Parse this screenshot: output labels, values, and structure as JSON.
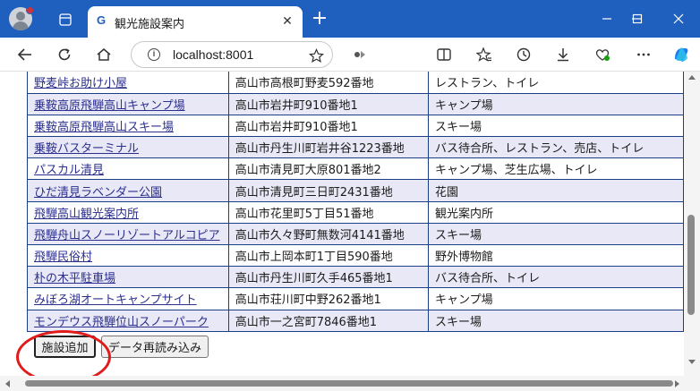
{
  "browser": {
    "tab_title": "観光施設案内",
    "favicon_letter": "G",
    "tab_close": "✕",
    "new_tab": "+",
    "address": "localhost:8001",
    "colors": {
      "titlebar": "#1f5fbd",
      "annotation": "#e21a1a"
    }
  },
  "facilities": [
    {
      "name": "野麦峠お助け小屋",
      "address": "高山市高根町野麦592番地",
      "amenities": "レストラン、トイレ"
    },
    {
      "name": "乗鞍高原飛騨高山キャンプ場",
      "address": "高山市岩井町910番地1",
      "amenities": "キャンプ場"
    },
    {
      "name": "乗鞍高原飛騨高山スキー場",
      "address": "高山市岩井町910番地1",
      "amenities": "スキー場"
    },
    {
      "name": "乗鞍バスターミナル",
      "address": "高山市丹生川町岩井谷1223番地",
      "amenities": "バス待合所、レストラン、売店、トイレ"
    },
    {
      "name": "パスカル清見",
      "address": "高山市清見町大原801番地2",
      "amenities": "キャンプ場、芝生広場、トイレ"
    },
    {
      "name": "ひだ清見ラベンダー公園",
      "address": "高山市清見町三日町2431番地",
      "amenities": "花園"
    },
    {
      "name": "飛騨高山観光案内所",
      "address": "高山市花里町5丁目51番地",
      "amenities": "観光案内所"
    },
    {
      "name": "飛騨舟山スノーリゾートアルコピア",
      "address": "高山市久々野町無数河4141番地",
      "amenities": "スキー場"
    },
    {
      "name": "飛騨民俗村",
      "address": "高山市上岡本町1丁目590番地",
      "amenities": "野外博物館"
    },
    {
      "name": "朴の木平駐車場",
      "address": "高山市丹生川町久手465番地1",
      "amenities": "バス待合所、トイレ"
    },
    {
      "name": "みぼろ湖オートキャンプサイト",
      "address": "高山市荘川町中野262番地1",
      "amenities": "キャンプ場"
    },
    {
      "name": "モンデウス飛騨位山スノーパーク",
      "address": "高山市一之宮町7846番地1",
      "amenities": "スキー場"
    }
  ],
  "buttons": {
    "add_facility": "施設追加",
    "reload_data": "データ再読み込み"
  }
}
